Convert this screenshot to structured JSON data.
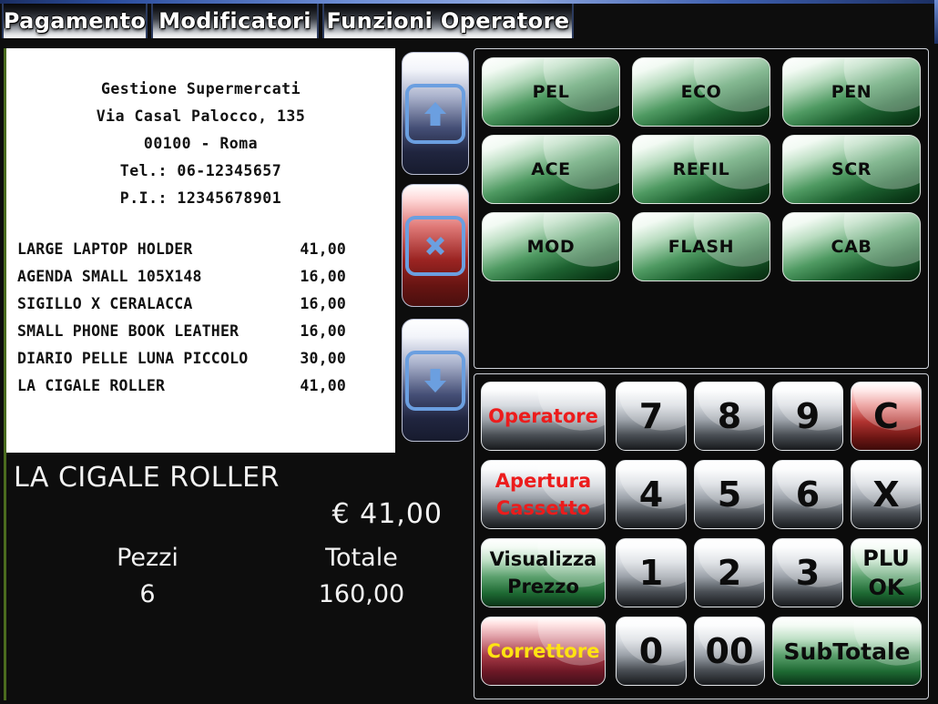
{
  "tabs": [
    {
      "label": "Pagamento"
    },
    {
      "label": "Modificatori"
    },
    {
      "label": "Funzioni Operatore"
    }
  ],
  "receipt": {
    "header": [
      "Gestione Supermercati",
      "Via Casal Palocco, 135",
      "00100 - Roma",
      "Tel.: 06-12345657",
      "P.I.: 12345678901"
    ],
    "items": [
      {
        "name": "LARGE LAPTOP HOLDER",
        "price": "41,00"
      },
      {
        "name": "AGENDA SMALL  105X148",
        "price": "16,00"
      },
      {
        "name": "SIGILLO X CERALACCA",
        "price": "16,00"
      },
      {
        "name": "SMALL PHONE BOOK LEATHER",
        "price": "16,00"
      },
      {
        "name": "DIARIO PELLE LUNA PICCOLO",
        "price": "30,00"
      },
      {
        "name": "LA CIGALE ROLLER",
        "price": "41,00"
      }
    ]
  },
  "display": {
    "item_name": "LA CIGALE ROLLER",
    "item_price": "€ 41,00",
    "pieces_label": "Pezzi",
    "pieces_value": "6",
    "total_label": "Totale",
    "total_value": "160,00"
  },
  "nav": {
    "up": "scroll-up",
    "cancel": "cancel-line",
    "down": "scroll-down"
  },
  "plu_buttons": [
    {
      "label": "PEL"
    },
    {
      "label": "ECO"
    },
    {
      "label": "PEN"
    },
    {
      "label": "ACE"
    },
    {
      "label": "REFIL"
    },
    {
      "label": "SCR"
    },
    {
      "label": "MOD"
    },
    {
      "label": "FLASH"
    },
    {
      "label": "CAB"
    }
  ],
  "keypad": {
    "functions": [
      {
        "line1": "Operatore",
        "line2": ""
      },
      {
        "line1": "Apertura",
        "line2": "Cassetto"
      },
      {
        "line1": "Visualizza",
        "line2": "Prezzo"
      },
      {
        "line1": "Correttore",
        "line2": ""
      }
    ],
    "digits": [
      "7",
      "8",
      "9",
      "4",
      "5",
      "6",
      "1",
      "2",
      "3",
      "0",
      "00"
    ],
    "clear": "C",
    "multiply": "X",
    "plu_ok_line1": "PLU",
    "plu_ok_line2": "OK",
    "subtotal": "SubTotale"
  },
  "colors": {
    "background": "#0d0d0d",
    "receipt_bg": "#ffffff",
    "accent_green": "#1d6130",
    "accent_red": "#b13330",
    "label_red": "#ec1c1c",
    "label_yellow": "#ffe312",
    "rim_blue": "#2b4d9e",
    "receipt_border_green": "#4a6b1e"
  }
}
